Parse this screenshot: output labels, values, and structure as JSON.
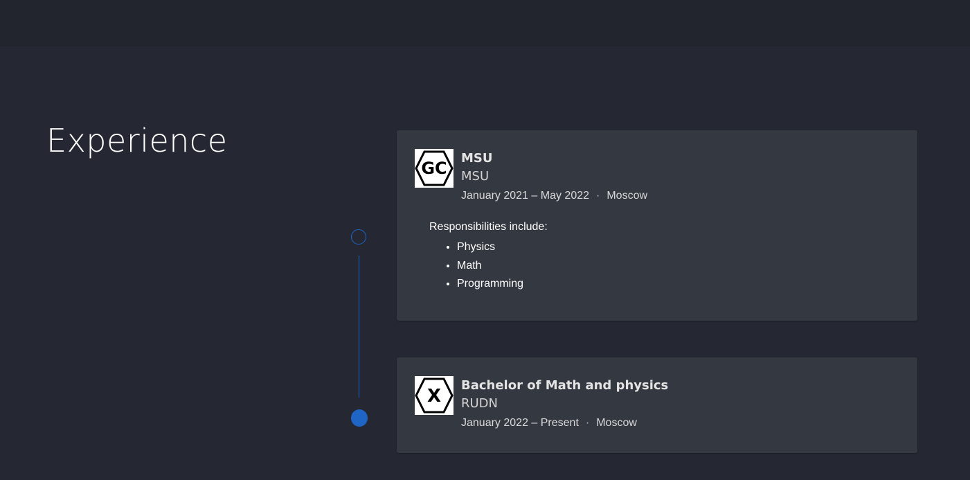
{
  "section": {
    "title": "Experience"
  },
  "timeline": {
    "accent_color": "#1e65c6"
  },
  "experiences": [
    {
      "logo_icon": "gc-hexagon-logo",
      "logo_text": "GC",
      "title": "MSU",
      "organization": "MSU",
      "dates": "January 2021 – May 2022",
      "separator": "·",
      "location": "Moscow",
      "description_intro": "Responsibilities include:",
      "items": [
        "Physics",
        "Math",
        "Programming"
      ]
    },
    {
      "logo_icon": "x-hexagon-logo",
      "logo_text": "X",
      "title": "Bachelor of Math and physics",
      "organization": "RUDN",
      "dates": "January 2022 – Present",
      "separator": "·",
      "location": "Moscow"
    }
  ]
}
